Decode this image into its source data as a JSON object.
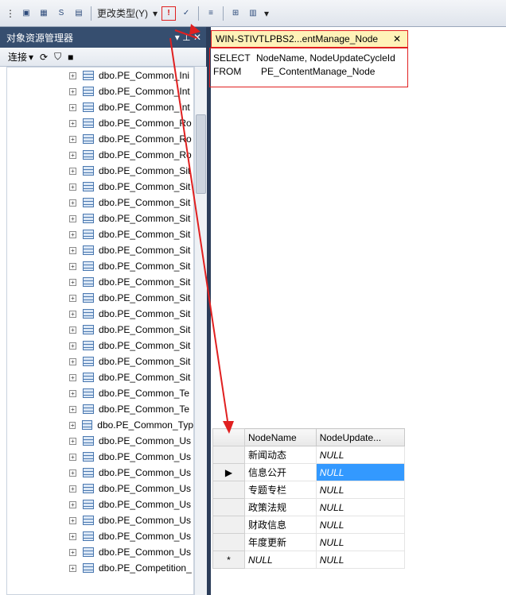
{
  "toolbar": {
    "change_type": "更改类型(Y)"
  },
  "object_explorer": {
    "title": "对象资源管理器",
    "connect": "连接",
    "items": [
      "dbo.PE_Common_Ini",
      "dbo.PE_Common_Int",
      "dbo.PE_Common_Int",
      "dbo.PE_Common_Ro",
      "dbo.PE_Common_Ro",
      "dbo.PE_Common_Ro",
      "dbo.PE_Common_Sit",
      "dbo.PE_Common_Sit",
      "dbo.PE_Common_Sit",
      "dbo.PE_Common_Sit",
      "dbo.PE_Common_Sit",
      "dbo.PE_Common_Sit",
      "dbo.PE_Common_Sit",
      "dbo.PE_Common_Sit",
      "dbo.PE_Common_Sit",
      "dbo.PE_Common_Sit",
      "dbo.PE_Common_Sit",
      "dbo.PE_Common_Sit",
      "dbo.PE_Common_Sit",
      "dbo.PE_Common_Sit",
      "dbo.PE_Common_Te",
      "dbo.PE_Common_Te",
      "dbo.PE_Common_Typ",
      "dbo.PE_Common_Us",
      "dbo.PE_Common_Us",
      "dbo.PE_Common_Us",
      "dbo.PE_Common_Us",
      "dbo.PE_Common_Us",
      "dbo.PE_Common_Us",
      "dbo.PE_Common_Us",
      "dbo.PE_Common_Us",
      "dbo.PE_Competition_"
    ]
  },
  "query": {
    "tab": "WIN-STIVTLPBS2...entManage_Node",
    "sql_line1": "SELECT",
    "sql_line1b": "NodeName, NodeUpdateCycleId",
    "sql_line2": "FROM",
    "sql_line2b": "PE_ContentManage_Node"
  },
  "results": {
    "headers": [
      "NodeName",
      "NodeUpdate..."
    ],
    "rows": [
      [
        "新闻动态",
        "NULL"
      ],
      [
        "信息公开",
        "NULL"
      ],
      [
        "专题专栏",
        "NULL"
      ],
      [
        "政策法规",
        "NULL"
      ],
      [
        "财政信息",
        "NULL"
      ],
      [
        "年度更新",
        "NULL"
      ],
      [
        "NULL",
        "NULL"
      ]
    ]
  }
}
